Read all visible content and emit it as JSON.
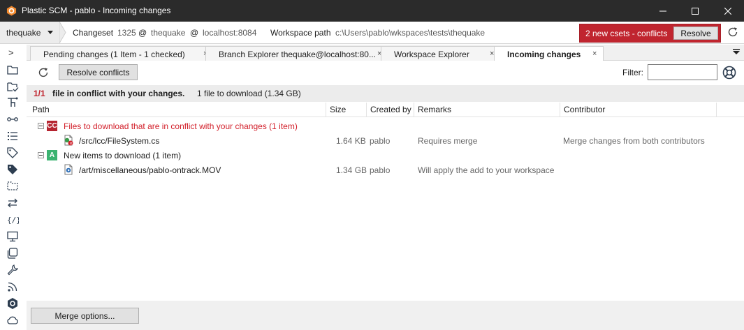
{
  "window": {
    "title": "Plastic SCM - pablo - Incoming changes",
    "controls": [
      "minimize-icon",
      "maximize-icon",
      "close-icon"
    ]
  },
  "toolbar": {
    "repo": "thequake",
    "changeset_label": "Changeset",
    "changeset_number": "1325",
    "at1": "@",
    "repo_name": "thequake",
    "at2": "@",
    "server": "localhost:8084",
    "workspace_label": "Workspace path",
    "workspace_path": "c:\\Users\\pablo\\wkspaces\\tests\\thequake",
    "conflict_notice": "2 new csets - conflicts",
    "resolve_label": "Resolve"
  },
  "sidebar": {
    "toggle": ">",
    "icons": [
      "folder-icon",
      "folder-check-icon",
      "branch-icon",
      "changeset-icon",
      "list-icon",
      "label-icon",
      "attribute-icon",
      "shelve-icon",
      "sync-icon",
      "code-icon",
      "monitor-icon",
      "stack-icon",
      "wrench-icon",
      "feed-icon",
      "plastic-logo-icon",
      "cloud-icon"
    ]
  },
  "tabs": [
    {
      "label": "Pending changes (1 Item - 1 checked)",
      "active": false
    },
    {
      "label": "Branch Explorer thequake@localhost:80...",
      "active": false
    },
    {
      "label": "Workspace Explorer",
      "active": false
    },
    {
      "label": "Incoming changes",
      "active": true
    }
  ],
  "tab_close": "×",
  "content": {
    "resolve_conflicts_label": "Resolve conflicts",
    "filter_label": "Filter:",
    "filter_value": "",
    "summary": {
      "count": "1/1",
      "text": "file in conflict with your changes.",
      "download": "1 file to download (1.34 GB)"
    },
    "columns": [
      "Path",
      "Size",
      "Created by",
      "Remarks",
      "Contributor"
    ],
    "groups": [
      {
        "badge": "CC",
        "badge_color": "#b52430",
        "title": "Files to download that are in conflict with your changes (1 item)",
        "title_color": "#d21f2a",
        "items": [
          {
            "path": "/src/lcc/FileSystem.cs",
            "size": "1.64 KB",
            "created_by": "pablo",
            "remarks": "Requires merge",
            "contributor": "Merge changes from both contributors"
          }
        ]
      },
      {
        "badge": "A",
        "badge_color": "#3cb371",
        "title": "New items to download (1 item)",
        "title_color": "#1e1e1e",
        "items": [
          {
            "path": "/art/miscellaneous/pablo-ontrack.MOV",
            "size": "1.34 GB",
            "created_by": "pablo",
            "remarks": "Will apply the add to your workspace",
            "contributor": ""
          }
        ]
      }
    ],
    "merge_options_label": "Merge options..."
  },
  "colors": {
    "accent_red": "#c0252f",
    "titlebar": "#2b2b2b"
  }
}
